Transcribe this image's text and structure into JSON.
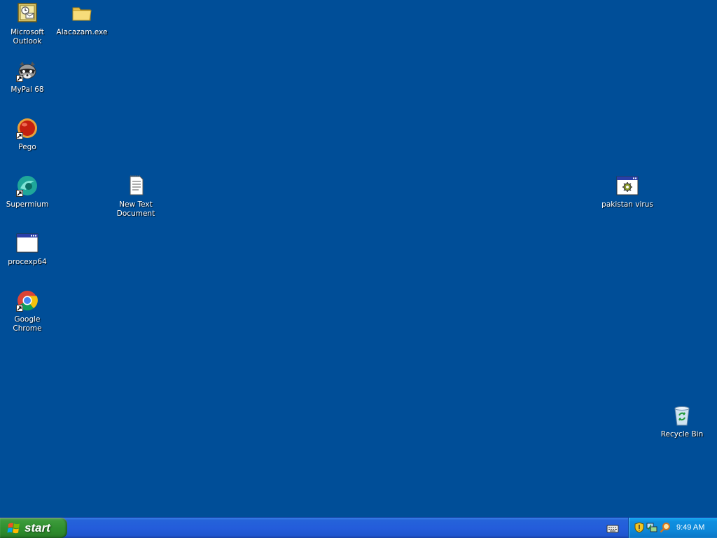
{
  "desktop": {
    "background_color": "#004e98",
    "icons": [
      {
        "label": "Microsoft\nOutlook",
        "icon": "outlook-icon"
      },
      {
        "label": "Alacazam.exe",
        "icon": "folder-icon"
      },
      {
        "label": "MyPal 68",
        "icon": "mypal-raccoon-icon",
        "shortcut": true
      },
      {
        "label": "Pego",
        "icon": "pego-red-ball-icon",
        "shortcut": true
      },
      {
        "label": "Supermium",
        "icon": "supermium-icon",
        "shortcut": true
      },
      {
        "label": "New Text\nDocument",
        "icon": "text-document-icon"
      },
      {
        "label": "pakistan virus",
        "icon": "application-window-icon"
      },
      {
        "label": "procexp64",
        "icon": "application-window-icon"
      },
      {
        "label": "Google Chrome",
        "icon": "chrome-icon",
        "shortcut": true
      },
      {
        "label": "Recycle Bin",
        "icon": "recycle-bin-icon"
      }
    ]
  },
  "taskbar": {
    "start_label": "start",
    "start_color": "#3c9a3a",
    "bar_color": "#245ddb",
    "tray": {
      "icons": [
        "security-shield-icon",
        "network-icon",
        "search-icon"
      ],
      "clock": "9:49 AM",
      "color": "#0e88d9"
    },
    "language_bar_icon": "keyboard-icon"
  }
}
